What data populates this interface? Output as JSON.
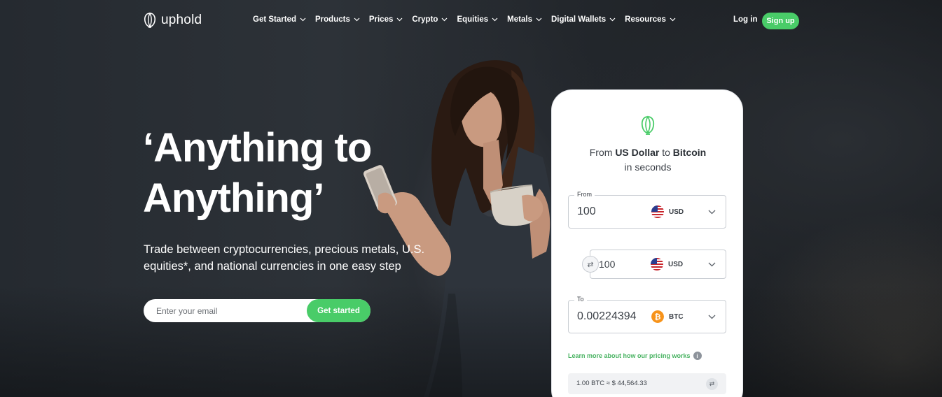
{
  "brand": {
    "name": "uphold",
    "accent": "#49cc68"
  },
  "nav": {
    "items": [
      {
        "label": "Get Started"
      },
      {
        "label": "Products"
      },
      {
        "label": "Prices"
      },
      {
        "label": "Crypto"
      },
      {
        "label": "Equities"
      },
      {
        "label": "Metals"
      },
      {
        "label": "Digital Wallets"
      },
      {
        "label": "Resources"
      }
    ],
    "login_label": "Log in",
    "signup_label": "Sign up"
  },
  "hero": {
    "headline": "‘Anything to Anything’",
    "subtext": "Trade between cryptocurrencies, precious metals, U.S. equities*, and national currencies in one easy step",
    "email_placeholder": "Enter your email",
    "cta_label": "Get started"
  },
  "widget": {
    "title_prefix": "From ",
    "title_from": "US Dollar",
    "title_mid": " to ",
    "title_to": "Bitcoin",
    "title_suffix": "in seconds",
    "from": {
      "label": "From",
      "value": "100",
      "currency": "USD"
    },
    "middle": {
      "value": "100",
      "currency": "USD"
    },
    "to": {
      "label": "To",
      "value": "0.00224394",
      "currency": "BTC"
    },
    "pricing_link": "Learn more about how our pricing works",
    "rate": "1.00 BTC ≈ $ 44,564.33"
  }
}
